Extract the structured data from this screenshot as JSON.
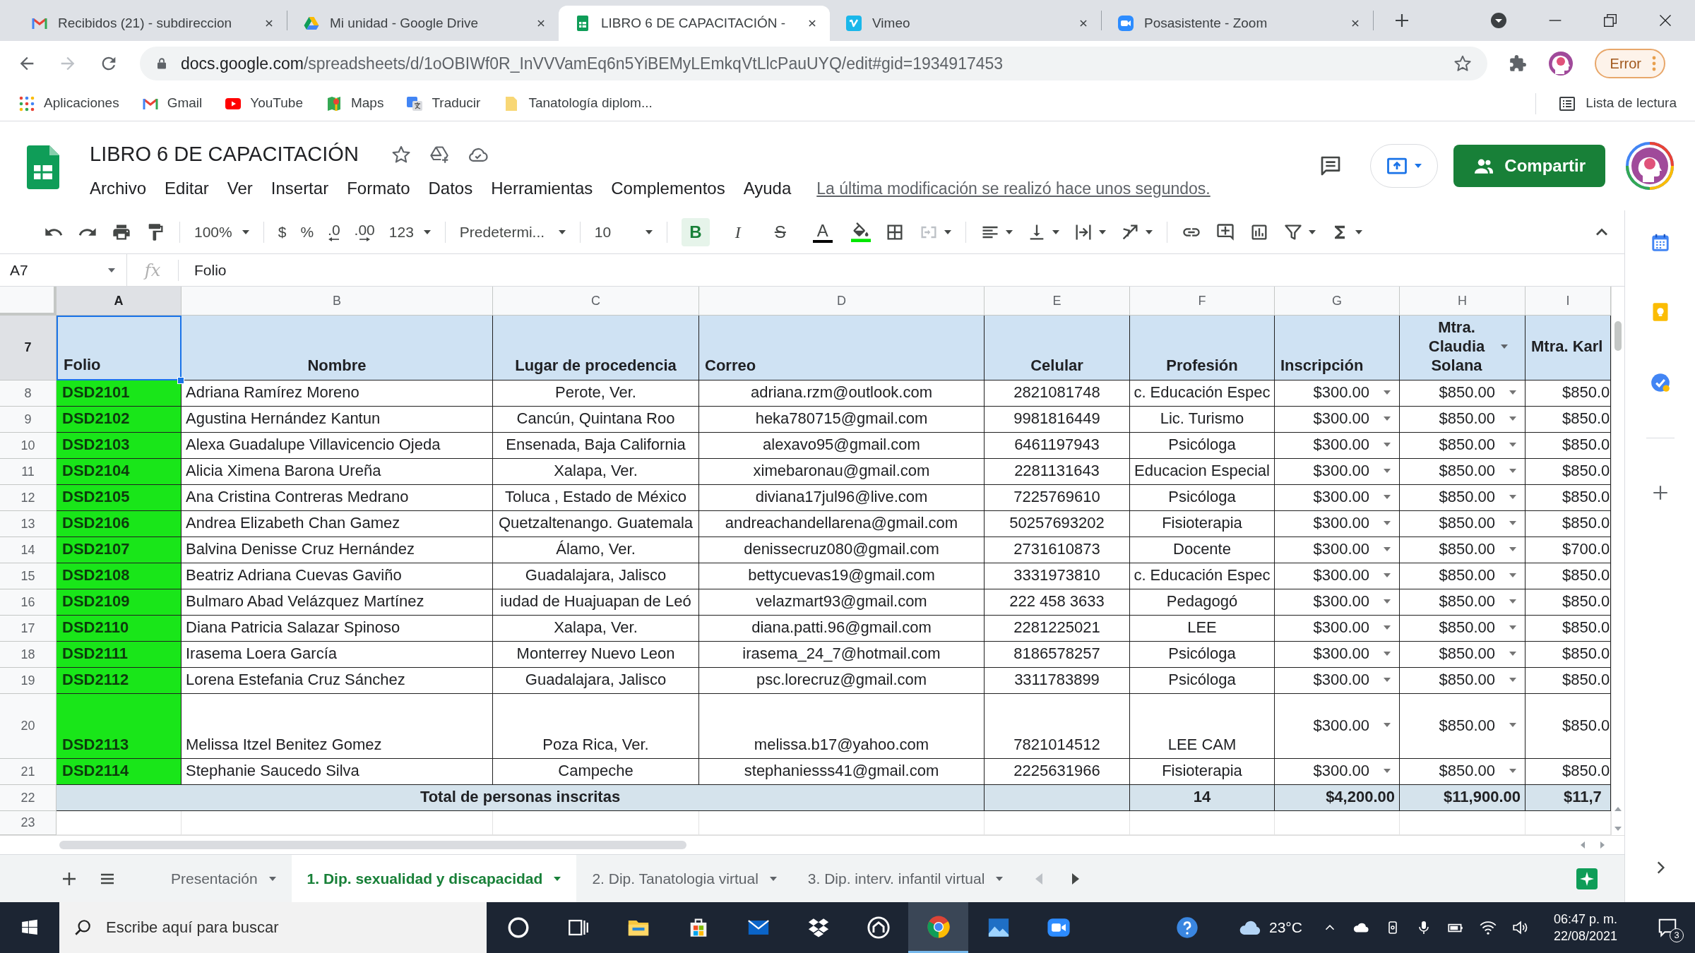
{
  "browser": {
    "tabs": [
      {
        "kind": "mail",
        "title": "Recibidos (21) - subdireccion",
        "selected": false
      },
      {
        "kind": "drive",
        "title": "Mi unidad - Google Drive",
        "selected": false
      },
      {
        "kind": "sheet",
        "title": "LIBRO 6 DE CAPACITACIÓN -",
        "selected": true
      },
      {
        "kind": "video",
        "title": "Vimeo",
        "selected": false
      },
      {
        "kind": "meeting",
        "title": "Posasistente - Zoom",
        "selected": false
      }
    ],
    "address": {
      "host": "docs.google.com",
      "path": "/spreadsheets/d/1oOBIWf0R_InVVVamEq6n5YiBEMyLEmkqVtLlcPauUYQ/edit#gid=1934917453"
    },
    "profile_button": "Error",
    "bookmarks": [
      {
        "kind": "apps",
        "label": "Aplicaciones"
      },
      {
        "kind": "mail",
        "label": "Gmail"
      },
      {
        "kind": "play",
        "label": "YouTube"
      },
      {
        "kind": "map",
        "label": "Maps"
      },
      {
        "kind": "translate",
        "label": "Traducir"
      },
      {
        "kind": "folder",
        "label": "Tanatología diplom..."
      }
    ],
    "reading_list": "Lista de lectura"
  },
  "document": {
    "title": "LIBRO 6 DE CAPACITACIÓN",
    "menus": [
      "Archivo",
      "Editar",
      "Ver",
      "Insertar",
      "Formato",
      "Datos",
      "Herramientas",
      "Complementos",
      "Ayuda"
    ],
    "last_edit": "La última modificación se realizó hace unos segundos.",
    "share_button": "Compartir"
  },
  "toolbar": {
    "zoom": "100%",
    "currency": "$",
    "percent": "%",
    "fewer_decimals": ".0",
    "more_decimals": ".00",
    "number_format": "123",
    "font": "Predetermi...",
    "font_size": "10",
    "text_styles": [
      {
        "kind": "bold",
        "label": "B",
        "active": true
      },
      {
        "kind": "italic",
        "label": "I",
        "active": false
      },
      {
        "kind": "strike",
        "label": "S",
        "active": false
      },
      {
        "kind": "color",
        "label": "A",
        "active": false
      }
    ]
  },
  "formula_bar": {
    "cell": "A7",
    "label": "fx",
    "value": "Folio"
  },
  "sheet": {
    "columns": [
      "A",
      "B",
      "C",
      "D",
      "E",
      "F",
      "G",
      "H",
      "I"
    ],
    "header": {
      "row": "7",
      "cells": [
        {
          "text": "Folio",
          "selected": true
        },
        {
          "text": "Nombre",
          "selected": false
        },
        {
          "text": "Lugar de procedencia",
          "selected": false
        },
        {
          "text": "Correo",
          "selected": false
        },
        {
          "text": "Celular",
          "selected": false
        },
        {
          "text": "Profesión",
          "selected": false
        },
        {
          "text": "Inscripción",
          "selected": false
        },
        {
          "text": "Mtra. Claudia Solana",
          "selected": false
        },
        {
          "text": "Mtra. Karl",
          "selected": false
        }
      ]
    },
    "rows": [
      {
        "row": "8",
        "tall": false,
        "cells": [
          "DSD2101",
          "Adriana Ramírez Moreno",
          "Perote, Ver.",
          "adriana.rzm@outlook.com",
          "2821081748",
          "c. Educación Espec",
          "$300.00",
          "$850.00",
          "$850.0"
        ]
      },
      {
        "row": "9",
        "tall": false,
        "cells": [
          "DSD2102",
          "Agustina Hernández Kantun",
          "Cancún, Quintana Roo",
          "heka780715@gmail.com",
          "9981816449",
          "Lic. Turismo",
          "$300.00",
          "$850.00",
          "$850.0"
        ]
      },
      {
        "row": "10",
        "tall": false,
        "cells": [
          "DSD2103",
          "Alexa Guadalupe Villavicencio Ojeda",
          "Ensenada, Baja California",
          "alexavo95@gmail.com",
          "6461197943",
          "Psicóloga",
          "$300.00",
          "$850.00",
          "$850.0"
        ]
      },
      {
        "row": "11",
        "tall": false,
        "cells": [
          "DSD2104",
          "Alicia Ximena Barona Ureña",
          "Xalapa, Ver.",
          "ximebaronau@gmail.com",
          "2281131643",
          "Educacion Especial",
          "$300.00",
          "$850.00",
          "$850.0"
        ]
      },
      {
        "row": "12",
        "tall": false,
        "cells": [
          "DSD2105",
          "Ana Cristina Contreras Medrano",
          "Toluca , Estado de México",
          "diviana17jul96@live.com",
          "7225769610",
          "Psicóloga",
          "$300.00",
          "$850.00",
          "$850.0"
        ]
      },
      {
        "row": "13",
        "tall": false,
        "cells": [
          "DSD2106",
          "Andrea Elizabeth Chan Gamez",
          "Quetzaltenango. Guatemala",
          "andreachandellarena@gmail.com",
          "50257693202",
          "Fisioterapia",
          "$300.00",
          "$850.00",
          "$850.0"
        ]
      },
      {
        "row": "14",
        "tall": false,
        "cells": [
          "DSD2107",
          "Balvina Denisse Cruz Hernández",
          "Álamo, Ver.",
          "denissecruz080@gmail.com",
          "2731610873",
          "Docente",
          "$300.00",
          "$850.00",
          "$700.0"
        ]
      },
      {
        "row": "15",
        "tall": false,
        "cells": [
          "DSD2108",
          "Beatriz Adriana Cuevas Gaviño",
          "Guadalajara, Jalisco",
          "bettycuevas19@gmail.com",
          "3331973810",
          "c. Educación Espec",
          "$300.00",
          "$850.00",
          "$850.0"
        ]
      },
      {
        "row": "16",
        "tall": false,
        "cells": [
          "DSD2109",
          "Bulmaro Abad Velázquez Martínez",
          "iudad de Huajuapan de Leó",
          "velazmart93@gmail.com",
          "222 458 3633",
          "Pedagogó",
          "$300.00",
          "$850.00",
          "$850.0"
        ]
      },
      {
        "row": "17",
        "tall": false,
        "cells": [
          "DSD2110",
          "Diana Patricia Salazar Spinoso",
          "Xalapa, Ver.",
          "diana.patti.96@gmail.com",
          "2281225021",
          "LEE",
          "$300.00",
          "$850.00",
          "$850.0"
        ]
      },
      {
        "row": "18",
        "tall": false,
        "cells": [
          "DSD2111",
          "Irasema Loera García",
          "Monterrey Nuevo Leon",
          "irasema_24_7@hotmail.com",
          "8186578257",
          "Psicóloga",
          "$300.00",
          "$850.00",
          "$850.0"
        ]
      },
      {
        "row": "19",
        "tall": false,
        "cells": [
          "DSD2112",
          "Lorena Estefania Cruz Sánchez",
          "Guadalajara, Jalisco",
          "psc.lorecruz@gmail.com",
          "3311783899",
          "Psicóloga",
          "$300.00",
          "$850.00",
          "$850.0"
        ]
      },
      {
        "row": "20",
        "tall": true,
        "cells": [
          "DSD2113",
          "Melissa Itzel Benitez Gomez",
          "Poza Rica, Ver.",
          "melissa.b17@yahoo.com",
          "7821014512",
          "LEE CAM",
          "$300.00",
          "$850.00",
          "$850.0"
        ]
      },
      {
        "row": "21",
        "tall": false,
        "cells": [
          "DSD2114",
          "Stephanie Saucedo Silva",
          "Campeche",
          "stephaniesss41@gmail.com",
          "2225631966",
          "Fisioterapia",
          "$300.00",
          "$850.00",
          "$850.0"
        ]
      }
    ],
    "total": {
      "row": "22",
      "label": "Total de personas inscritas",
      "cells": [
        "14",
        "$4,200.00",
        "$11,900.00",
        "$11,7"
      ]
    },
    "empty_rows": [
      "23"
    ]
  },
  "sheet_tabs": [
    {
      "label": "Presentación",
      "selected": false
    },
    {
      "label": "1. Dip. sexualidad y discapacidad",
      "selected": true
    },
    {
      "label": "2. Dip. Tanatologia virtual",
      "selected": false
    },
    {
      "label": "3. Dip. interv. infantil virtual",
      "selected": false
    }
  ],
  "taskbar": {
    "search": {
      "placeholder": "Escribe aquí para buscar"
    },
    "apps": [
      {
        "kind": "ring",
        "active": false
      },
      {
        "kind": "taskview",
        "active": false
      },
      {
        "kind": "files",
        "active": false
      },
      {
        "kind": "store",
        "active": false
      },
      {
        "kind": "mail",
        "active": false
      },
      {
        "kind": "diamonds",
        "active": false
      },
      {
        "kind": "house",
        "active": false
      },
      {
        "kind": "browser",
        "active": true
      },
      {
        "kind": "photos",
        "active": false
      },
      {
        "kind": "meeting",
        "active": false
      }
    ],
    "weather": "23°C",
    "time": "06:47 p. m.",
    "date": "22/08/2021",
    "notifications": "3"
  }
}
